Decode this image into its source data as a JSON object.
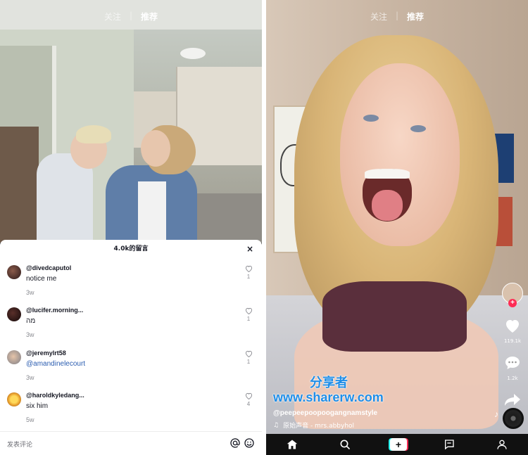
{
  "left_screen": {
    "top_tabs": {
      "following": "关注",
      "for_you": "推荐",
      "separator": "|"
    },
    "comments_panel": {
      "title": "4.0k的留言",
      "close_label": "×",
      "comments": [
        {
          "user": "@divedcaputol",
          "text": "notice me",
          "time": "3w",
          "likes": "1"
        },
        {
          "user": "@lucifer.morning...",
          "text": "מה",
          "time": "3w",
          "likes": "1"
        },
        {
          "user": "@jeremylrt58",
          "text": "@amandinelecourt",
          "time": "3w",
          "likes": "1"
        },
        {
          "user": "@haroldkyledang...",
          "text": "six him",
          "time": "5w",
          "likes": "4"
        }
      ],
      "input_placeholder": "发表评论"
    }
  },
  "right_screen": {
    "top_tabs": {
      "following": "关注",
      "for_you": "推荐",
      "separator": "|"
    },
    "actions": {
      "likes": "119.1k",
      "comments": "1.2k",
      "share": "分享"
    },
    "watermark": {
      "cn": "分享者",
      "url": "www.sharerw.com"
    },
    "username": "@peepeepoopoogangnamstyle",
    "music": "原始声音 - mrs.abbyhol"
  },
  "colors": {
    "accent_red": "#fe2c55",
    "accent_cyan": "#25f4ee",
    "mention_blue": "#2b5db0"
  }
}
